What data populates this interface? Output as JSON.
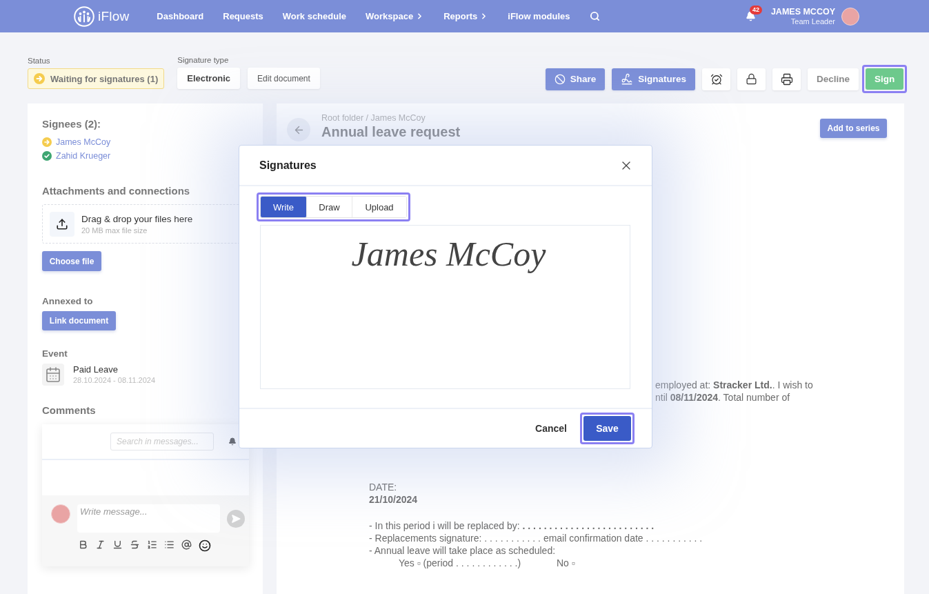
{
  "nav": {
    "logo": "iFlow",
    "items": [
      {
        "label": "Dashboard",
        "has_submenu": false
      },
      {
        "label": "Requests",
        "has_submenu": false
      },
      {
        "label": "Work schedule",
        "has_submenu": false
      },
      {
        "label": "Workspace",
        "has_submenu": true
      },
      {
        "label": "Reports",
        "has_submenu": true
      },
      {
        "label": "iFlow modules",
        "has_submenu": false
      }
    ],
    "notification_count": "42",
    "user": {
      "name": "JAMES MCCOY",
      "role": "Team Leader"
    }
  },
  "toolbar": {
    "status_label": "Status",
    "status": "Waiting for signatures (1)",
    "signature_type_label": "Signature type",
    "signature_type": "Electronic",
    "edit_button": "Edit document",
    "share_button": "Share",
    "signatures_button": "Signatures",
    "decline_button": "Decline",
    "sign_button": {
      "label": "Sign",
      "highlighted": true
    }
  },
  "sidebar": {
    "signees": {
      "title": "Signees (2):",
      "items": [
        {
          "name": "James McCoy",
          "signed": false
        },
        {
          "name": "Zahid Krueger",
          "signed": true
        }
      ]
    },
    "attachments": {
      "title": "Attachments and connections",
      "drop_text": "Drag & drop your files here",
      "hint": "20 MB max file size",
      "button": "Choose file"
    },
    "annexed": {
      "title": "Annexed to",
      "button": "Link document"
    },
    "event": {
      "title": "Event",
      "name": "Paid Leave",
      "dates": "28.10.2024 - 08.11.2024"
    },
    "comments": {
      "title": "Comments",
      "search": {
        "placeholder": "Search in messages..."
      },
      "message": {
        "placeholder": "Write message..."
      }
    }
  },
  "document": {
    "breadcrumb": "Root folder / James McCoy",
    "title": "Annual leave request",
    "add_button": "Add to series",
    "fragments": [
      "employed at: **Stracker Ltd.**. I wish to",
      "ntil **08/11/2024**. Total number of"
    ],
    "date_label": "DATE:",
    "date": "21/10/2024",
    "clauses": [
      "- In this period i will be replaced by: **. . . . . . . . . . . . . . . . . . . . . . . . .**",
      "- Replacements signature: . . . . . . . . . . . email confirmation date . . . . . . . . . . .",
      "- Annual leave will take place as scheduled:"
    ],
    "options": [
      "Yes ▫ (period . . . . . . . . . . . .)",
      "No ▫"
    ]
  },
  "modal": {
    "title": "Signatures",
    "tabs": [
      {
        "label": "Write",
        "selected": true
      },
      {
        "label": "Draw",
        "selected": false
      },
      {
        "label": "Upload",
        "selected": false
      }
    ],
    "tabs_highlighted": true,
    "signature": "James McCoy",
    "cancel_button": "Cancel",
    "save_button": {
      "label": "Save",
      "highlighted": true
    }
  }
}
